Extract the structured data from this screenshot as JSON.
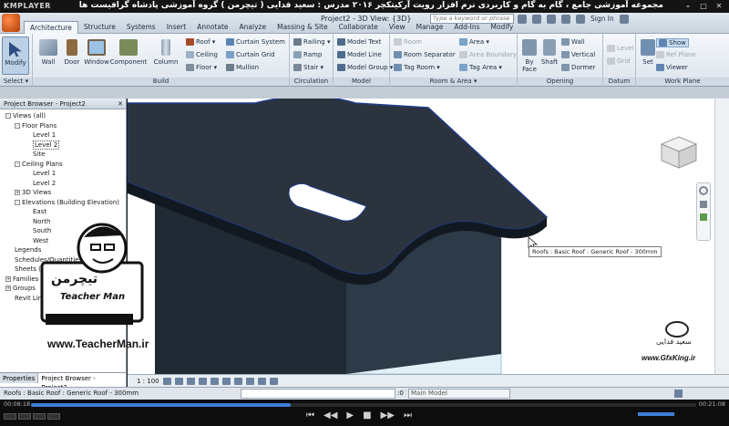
{
  "player": {
    "logo": "KMPLAYER",
    "title": "مجموعه آموزشی جامع ، گام به گام و کاربردی نرم افزار رویت آرکیتکچر ۲۰۱۶  مدرس : سعید فدایی ( تیچرمن ) گروه آموزشی پادشاه گرافیست ها",
    "time_elapsed": "00:08:18",
    "time_total": "00:21:08",
    "progress": 0.39
  },
  "revit": {
    "doc_title": "Project2 - 3D View: {3D}",
    "search_placeholder": "Type a keyword or phrase",
    "sign_in": "Sign In",
    "tabs": [
      "Architecture",
      "Structure",
      "Systems",
      "Insert",
      "Annotate",
      "Analyze",
      "Massing & Site",
      "Collaborate",
      "View",
      "Manage",
      "Add-Ins",
      "Modify"
    ],
    "active_tab": "Architecture"
  },
  "ribbon": {
    "select": {
      "modify": "Modify",
      "label": "Select ▾"
    },
    "build": {
      "label": "Build",
      "wall": "Wall",
      "door": "Door",
      "window": "Window",
      "component": "Component",
      "column": "Column",
      "roof": "Roof ▾",
      "ceiling": "Ceiling",
      "floor": "Floor ▾",
      "curtain_system": "Curtain System",
      "curtain_grid": "Curtain Grid",
      "mullion": "Mullion"
    },
    "circulation": {
      "label": "Circulation",
      "railing": "Railing ▾",
      "ramp": "Ramp",
      "stair": "Stair ▾"
    },
    "model": {
      "label": "Model",
      "model_text": "Model Text",
      "model_line": "Model Line",
      "model_group": "Model Group ▾"
    },
    "room_area": {
      "label": "Room & Area ▾",
      "room": "Room",
      "room_separator": "Room Separator",
      "tag_room": "Tag Room ▾",
      "area": "Area ▾",
      "area_boundary": "Area Boundary",
      "tag_area": "Tag Area ▾"
    },
    "opening": {
      "label": "Opening",
      "by_face": "By Face",
      "shaft": "Shaft",
      "wall": "Wall",
      "vertical": "Vertical",
      "dormer": "Dormer"
    },
    "datum": {
      "label": "Datum",
      "level": "Level",
      "grid": "Grid"
    },
    "work_plane": {
      "label": "Work Plane",
      "set": "Set",
      "show": "Show",
      "ref_plane": "Ref Plane",
      "viewer": "Viewer"
    }
  },
  "browser": {
    "title": "Project Browser - Project2",
    "tree": [
      {
        "label": "Views (all)",
        "depth": 0,
        "toggle": "-"
      },
      {
        "label": "Floor Plans",
        "depth": 1,
        "toggle": "-"
      },
      {
        "label": "Level 1",
        "depth": 2,
        "toggle": ""
      },
      {
        "label": "Level 2",
        "depth": 2,
        "toggle": "",
        "selected": true
      },
      {
        "label": "Site",
        "depth": 2,
        "toggle": ""
      },
      {
        "label": "Ceiling Plans",
        "depth": 1,
        "toggle": "-"
      },
      {
        "label": "Level 1",
        "depth": 2,
        "toggle": ""
      },
      {
        "label": "Level 2",
        "depth": 2,
        "toggle": ""
      },
      {
        "label": "3D Views",
        "depth": 1,
        "toggle": "+"
      },
      {
        "label": "Elevations (Building Elevation)",
        "depth": 1,
        "toggle": "-"
      },
      {
        "label": "East",
        "depth": 2,
        "toggle": ""
      },
      {
        "label": "North",
        "depth": 2,
        "toggle": ""
      },
      {
        "label": "South",
        "depth": 2,
        "toggle": ""
      },
      {
        "label": "West",
        "depth": 2,
        "toggle": ""
      },
      {
        "label": "Legends",
        "depth": 0,
        "toggle": ""
      },
      {
        "label": "Schedules/Quantities",
        "depth": 0,
        "toggle": ""
      },
      {
        "label": "Sheets (all)",
        "depth": 0,
        "toggle": ""
      },
      {
        "label": "Families",
        "depth": 0,
        "toggle": "+"
      },
      {
        "label": "Groups",
        "depth": 0,
        "toggle": "+"
      },
      {
        "label": "Revit Links",
        "depth": 0,
        "toggle": ""
      }
    ],
    "tab_properties": "Properties",
    "tab_browser": "Project Browser - Project2"
  },
  "viewport": {
    "tooltip": "Roofs : Basic Roof : Generic Roof - 300mm",
    "scale": "1 : 100"
  },
  "status": {
    "text": "Roofs : Basic Roof : Generic Roof - 300mm",
    "model_select": "Main Model",
    "zero": ":0"
  },
  "watermark": {
    "teacher_url": "www.TeacherMan.ir",
    "teacher_name": "Teacher Man",
    "teacher_fa": "تیچرمن",
    "gfx_url": "www.GfxKing.ir",
    "gfx_fa": "سعید فدایی"
  }
}
